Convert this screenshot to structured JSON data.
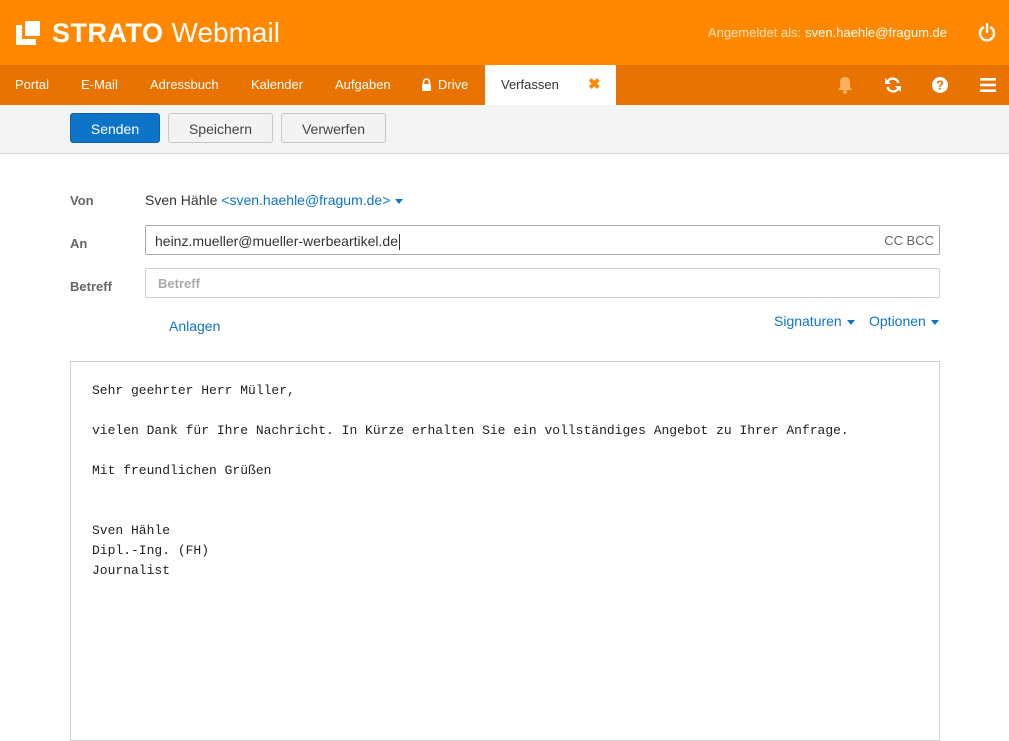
{
  "header": {
    "brand": "STRATO",
    "product": "Webmail",
    "login_label": "Angemeldet als:",
    "login_user": "sven.haehle@fragum.de"
  },
  "nav": {
    "items": [
      "Portal",
      "E-Mail",
      "Adressbuch",
      "Kalender",
      "Aufgaben",
      "Drive"
    ],
    "active_tab": "Verfassen"
  },
  "toolbar": {
    "send_label": "Senden",
    "save_label": "Speichern",
    "discard_label": "Verwerfen"
  },
  "form": {
    "from_label": "Von",
    "from_name": "Sven Hähle",
    "from_address": "<sven.haehle@fragum.de>",
    "to_label": "An",
    "to_value": "heinz.mueller@mueller-werbeartikel.de",
    "cc_label": "CC",
    "bcc_label": "BCC",
    "subject_label": "Betreff",
    "subject_placeholder": "Betreff",
    "attachments_label": "Anlagen",
    "signatures_label": "Signaturen",
    "options_label": "Optionen"
  },
  "body": {
    "lines": [
      "Sehr geehrter Herr Müller,",
      "vielen Dank für Ihre Nachricht. In Kürze erhalten Sie ein vollständiges Angebot zu Ihrer Anfrage.",
      "Mit freundlichen Grüßen",
      "Sven Hähle",
      "Dipl.-Ing. (FH)",
      "Journalist"
    ]
  },
  "colors": {
    "brand_orange": "#ff8800",
    "nav_orange": "#e87300",
    "primary_blue": "#0d74c7"
  },
  "icons": [
    "strato-logo-icon",
    "power-icon",
    "lock-icon",
    "close-icon",
    "bell-icon",
    "refresh-icon",
    "help-icon",
    "menu-icon",
    "caret-down-icon"
  ]
}
